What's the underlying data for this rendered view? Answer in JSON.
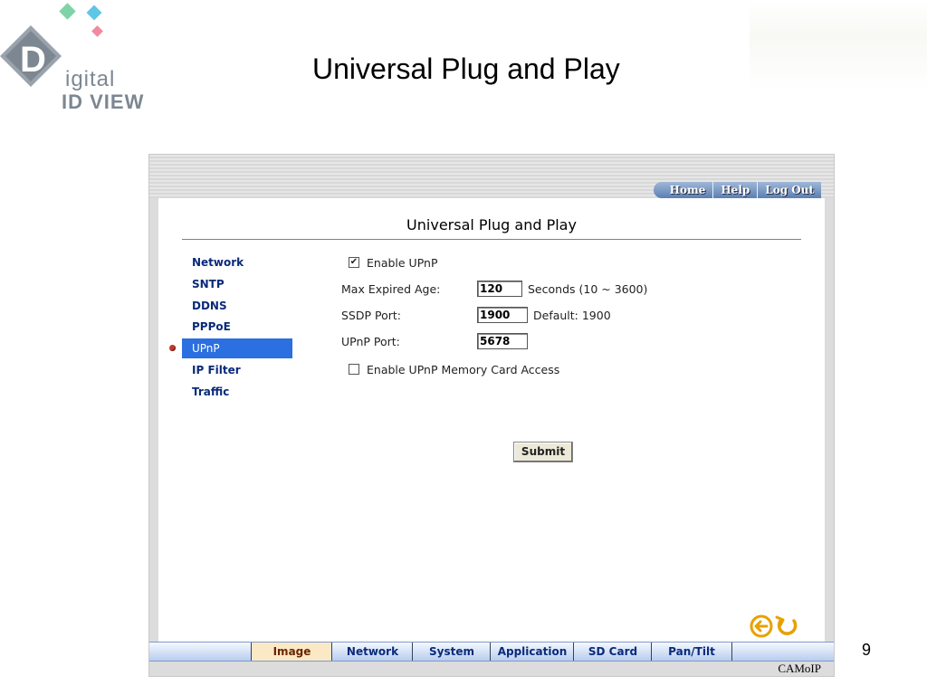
{
  "slide": {
    "title": "Universal Plug and Play",
    "page_number": "9"
  },
  "logo": {
    "line1": "igital",
    "line2": "ID VIEW",
    "letter": "D"
  },
  "camera_ui": {
    "top_nav": [
      "Home",
      "Help",
      "Log Out"
    ],
    "content_title": "Universal Plug and Play",
    "sidebar": [
      {
        "label": "Network",
        "active": false
      },
      {
        "label": "SNTP",
        "active": false
      },
      {
        "label": "DDNS",
        "active": false
      },
      {
        "label": "PPPoE",
        "active": false
      },
      {
        "label": "UPnP",
        "active": true
      },
      {
        "label": "IP Filter",
        "active": false
      },
      {
        "label": "Traffic",
        "active": false
      }
    ],
    "form": {
      "enable_upnp_label": "Enable UPnP",
      "enable_upnp_checked": true,
      "max_age_label": "Max Expired Age:",
      "max_age_value": "120",
      "max_age_hint": "Seconds (10 ~ 3600)",
      "ssdp_label": "SSDP Port:",
      "ssdp_value": "1900",
      "ssdp_hint": "Default: 1900",
      "upnp_port_label": "UPnP Port:",
      "upnp_port_value": "5678",
      "memory_card_label": "Enable UPnP Memory Card Access",
      "memory_card_checked": false,
      "submit_label": "Submit"
    },
    "bottom_nav": [
      "Image",
      "Network",
      "System",
      "Application",
      "SD Card",
      "Pan/Tilt"
    ],
    "brand": "CAMoIP",
    "colors": {
      "active_item": "#2b6fe0",
      "nav_text": "#0a2a7a",
      "arrow_orange": "#e8a000"
    }
  }
}
